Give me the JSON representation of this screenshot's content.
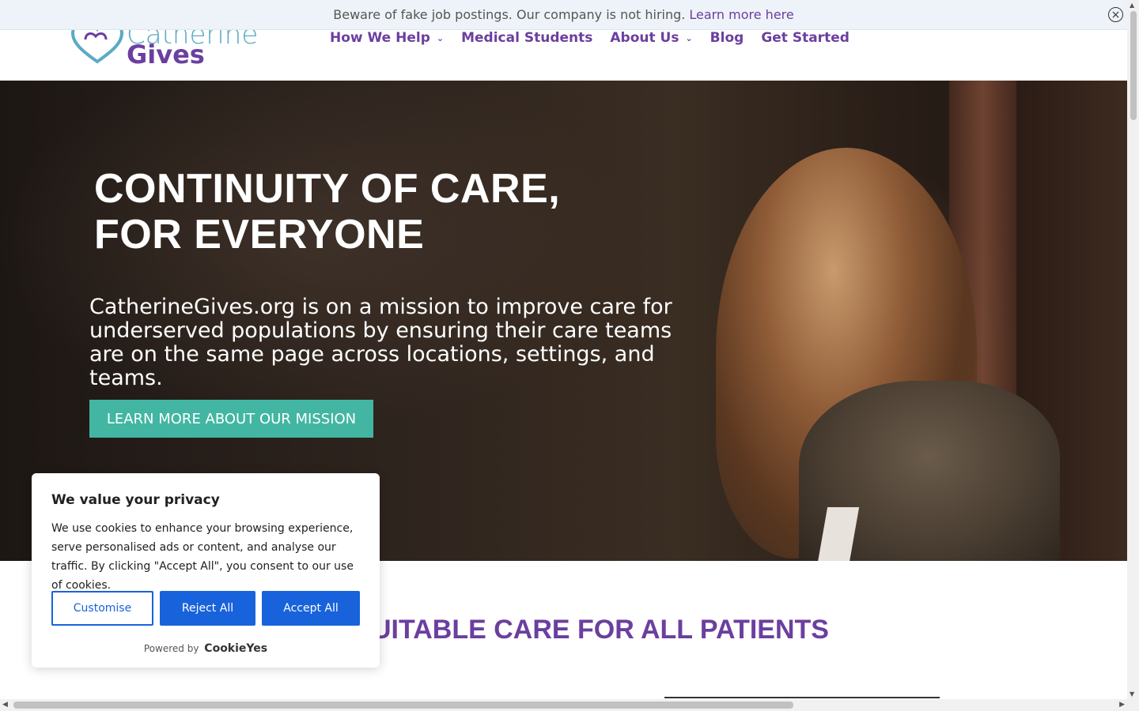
{
  "notice": {
    "text": "Beware of fake job postings. Our company is not hiring.",
    "link": "Learn more here",
    "close_icon": "close-circle-icon"
  },
  "header": {
    "logo_word1": "Catherine",
    "logo_word2": "Gives",
    "nav": [
      {
        "label": "How We Help",
        "has_dropdown": true
      },
      {
        "label": "Medical Students",
        "has_dropdown": false
      },
      {
        "label": "About Us",
        "has_dropdown": true
      },
      {
        "label": "Blog",
        "has_dropdown": false
      },
      {
        "label": "Get Started",
        "has_dropdown": false
      }
    ]
  },
  "hero": {
    "title_line1": "CONTINUITY OF CARE,",
    "title_line2": "FOR EVERYONE",
    "subtitle": "CatherineGives.org is on a mission to improve care for underserved populations by ensuring their care teams are on the same page across locations, settings, and teams.",
    "button": "LEARN MORE ABOUT OUR MISSION"
  },
  "section": {
    "heading_visible": "UITABLE CARE FOR ALL PATIENTS"
  },
  "cookie": {
    "title": "We value your privacy",
    "body": "We use cookies to enhance your browsing experience, serve personalised ads or content, and analyse our traffic. By clicking \"Accept All\", you consent to our use of cookies.",
    "customise": "Customise",
    "reject": "Reject All",
    "accept": "Accept All",
    "powered_by": "Powered by",
    "brand": "CookieYes"
  },
  "colors": {
    "brand_purple": "#6b3f9f",
    "teal": "#42b6a2",
    "cookie_blue": "#1863dc"
  }
}
